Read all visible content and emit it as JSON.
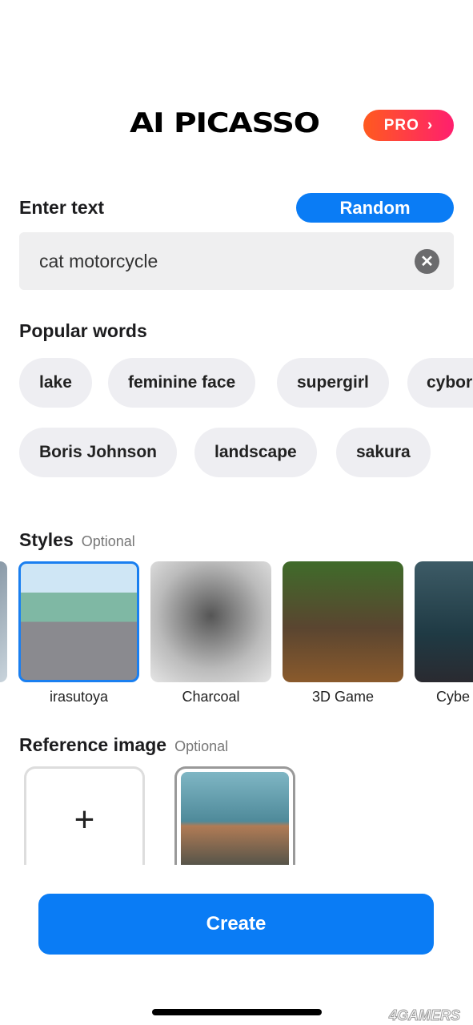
{
  "header": {
    "logo": "AI PICASSO",
    "pro_label": "PRO",
    "pro_icon": "chevron-right-icon",
    "pro_gradient": [
      "#ff5a1f",
      "#ff1f6e"
    ]
  },
  "prompt": {
    "title": "Enter text",
    "random_label": "Random",
    "value": "cat motorcycle",
    "clear_icon": "x-circle-icon"
  },
  "popular": {
    "title": "Popular words",
    "row1": [
      "lake",
      "feminine face",
      "supergirl",
      "cybor"
    ],
    "row2": [
      "Boris Johnson",
      "landscape",
      "sakura"
    ]
  },
  "styles": {
    "title": "Styles",
    "optional": "Optional",
    "items": [
      {
        "label": "irasutoya",
        "selected": true
      },
      {
        "label": "Charcoal"
      },
      {
        "label": "3D Game"
      },
      {
        "label": "Cybe"
      }
    ]
  },
  "reference": {
    "title": "Reference image",
    "optional": "Optional",
    "add_icon": "plus-icon"
  },
  "create_label": "Create",
  "accent": "#0a7cf5",
  "watermark": "4GAMERS"
}
